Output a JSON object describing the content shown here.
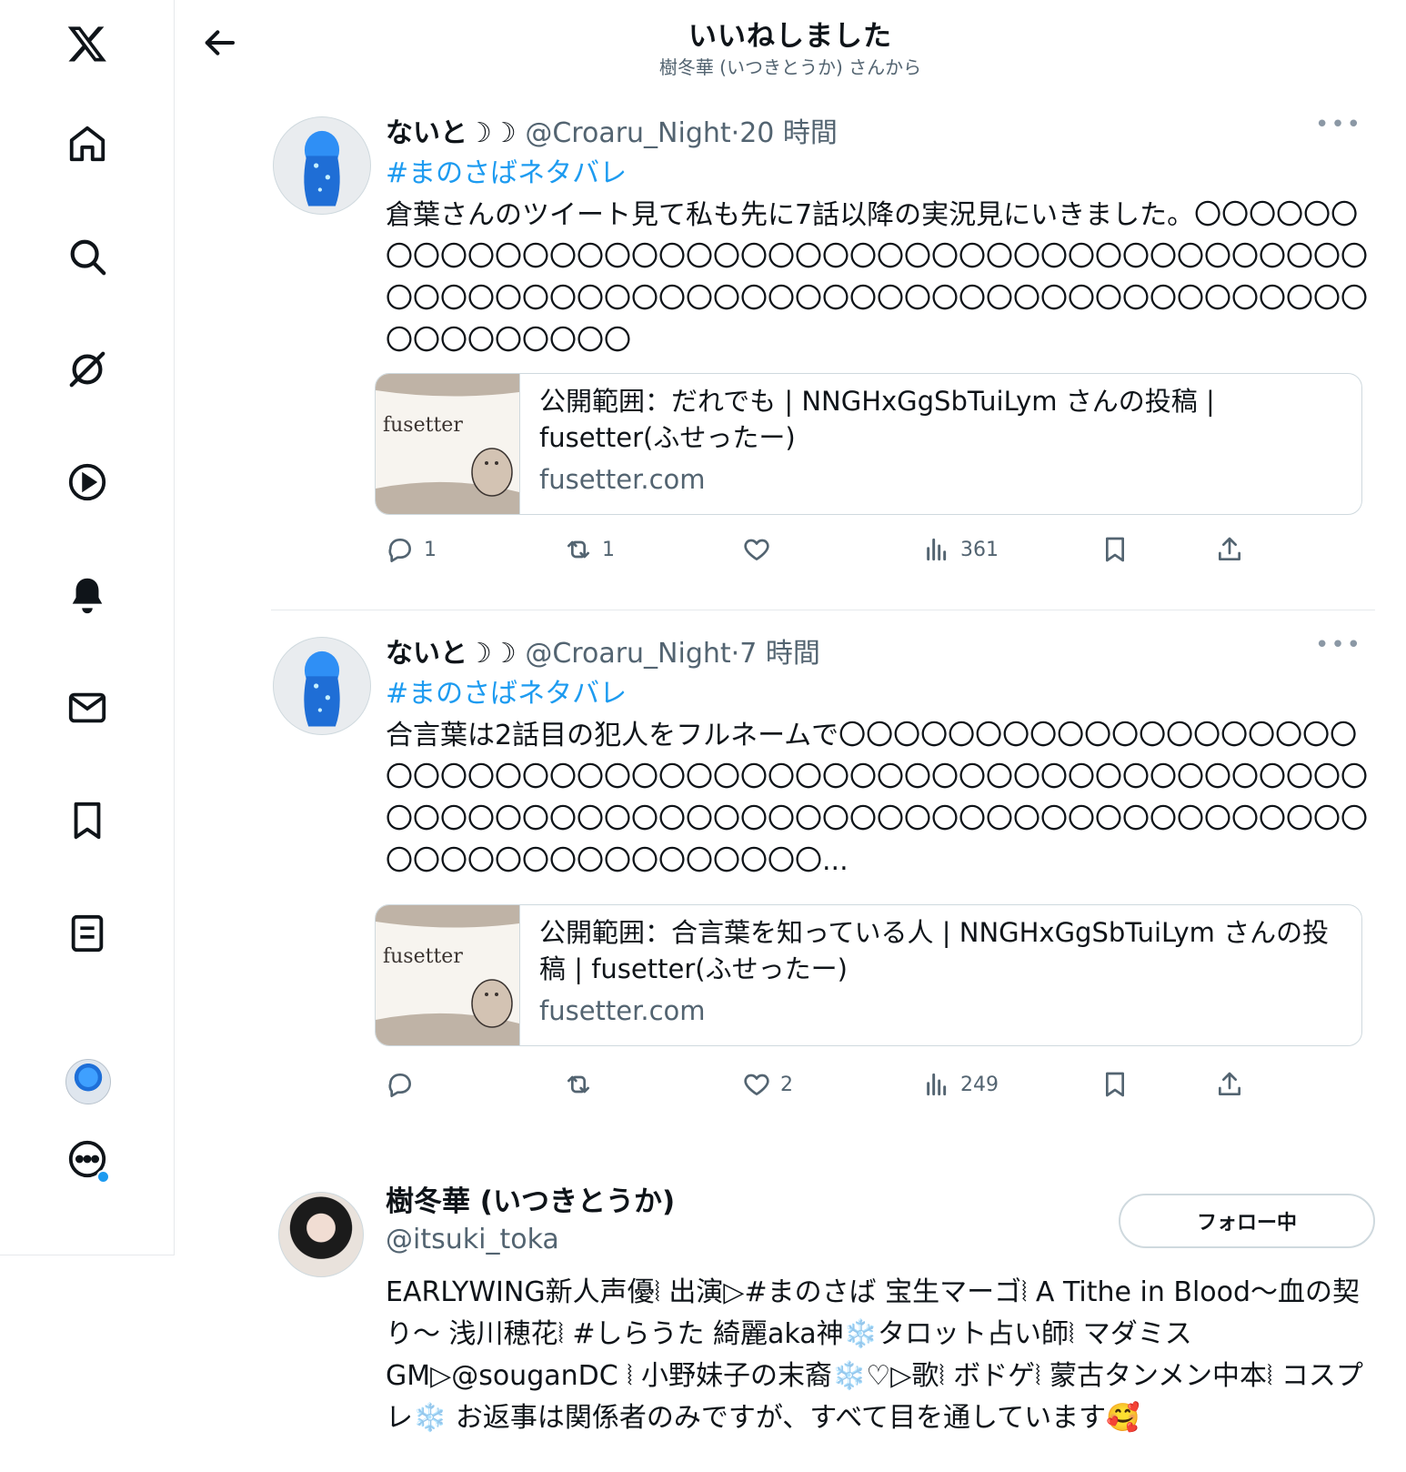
{
  "header": {
    "title": "いいねしました",
    "subtitle": "樹冬華 (いつきとうか) さんから"
  },
  "sidebar": {
    "items": [
      {
        "name": "x-logo-icon"
      },
      {
        "name": "home-icon"
      },
      {
        "name": "search-icon"
      },
      {
        "name": "grok-icon"
      },
      {
        "name": "video-icon"
      },
      {
        "name": "notifications-icon"
      },
      {
        "name": "messages-icon"
      },
      {
        "name": "bookmarks-icon"
      },
      {
        "name": "lists-icon"
      },
      {
        "name": "profile-avatar"
      },
      {
        "name": "more-icon"
      }
    ]
  },
  "tweets": [
    {
      "name": "ないと☽☽",
      "handle": "@Croaru_Night",
      "time": "20 時間",
      "hashtag": "#まのさばネタバレ",
      "text": "倉葉さんのツイート見て私も先に7話以降の実況見にいきました。〇〇〇〇〇〇〇〇〇〇〇〇〇〇〇〇〇〇〇〇〇〇〇〇〇〇〇〇〇〇〇〇〇〇〇〇〇〇〇〇〇〇〇〇〇〇〇〇〇〇〇〇〇〇〇〇〇〇〇〇〇〇〇〇〇〇〇〇〇〇〇〇〇〇〇〇〇〇〇〇〇〇〇〇〇〇〇",
      "card": {
        "title": "公開範囲：だれでも | NNGHxGgSbTuiLym さんの投稿 | fusetter(ふせったー)",
        "domain": "fusetter.com",
        "thumb_text": "fusetter"
      },
      "stats": {
        "replies": "1",
        "retweets": "1",
        "likes": "",
        "views": "361"
      }
    },
    {
      "name": "ないと☽☽",
      "handle": "@Croaru_Night",
      "time": "7 時間",
      "hashtag": "#まのさばネタバレ",
      "text": "合言葉は2話目の犯人をフルネームで〇〇〇〇〇〇〇〇〇〇〇〇〇〇〇〇〇〇〇〇〇〇〇〇〇〇〇〇〇〇〇〇〇〇〇〇〇〇〇〇〇〇〇〇〇〇〇〇〇〇〇〇〇〇〇〇〇〇〇〇〇〇〇〇〇〇〇〇〇〇〇〇〇〇〇〇〇〇〇〇〇〇〇〇〇〇〇〇〇〇〇〇〇〇〇〇〇〇〇〇〇〇〇〇〇〇〇...",
      "card": {
        "title": "公開範囲：合言葉を知っている人 | NNGHxGgSbTuiLym さんの投稿 | fusetter(ふせったー)",
        "domain": "fusetter.com",
        "thumb_text": "fusetter"
      },
      "stats": {
        "replies": "",
        "retweets": "",
        "likes": "2",
        "views": "249"
      }
    }
  ],
  "profile": {
    "name": "樹冬華 (いつきとうか)",
    "handle": "@itsuki_toka",
    "follow_label": "フォロー中",
    "bio": "EARLYWING新人声優⦚ 出演▷#まのさば 宝生マーゴ⦚ A Tithe in Blood～血の契り～ 浅川穂花⦚ #しらうた 綺麗aka神❄️タロット占い師⦚ マダミスGM▷@souganDC ⦚ 小野妹子の末裔❄️♡▷歌⦚ ボドゲ⦚ 蒙古タンメン中本⦚ コスプレ❄️ お返事は関係者のみですが、すべて目を通しています🥰"
  },
  "colors": {
    "accent": "#1d9bf0",
    "muted": "#536471",
    "border": "#cfd9de"
  }
}
